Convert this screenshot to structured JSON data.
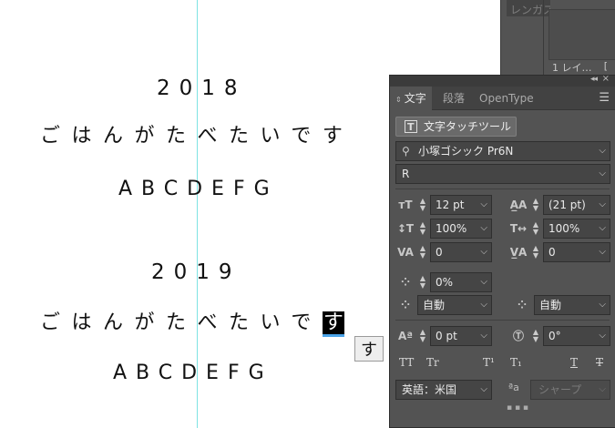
{
  "artboard": {
    "line1": "2018",
    "line2": "ごはんがたべたいです",
    "line3": "ABCDEFG",
    "line4": "2019",
    "line5_main": "ごはんがたべたいで",
    "line5_selected": "す",
    "line6": "ABCDEFG",
    "ime_candidate": "す"
  },
  "background_panel": {
    "tab_label": "レンガス",
    "footer_label": "1 レイ…",
    "footer_menu": "[ "
  },
  "character_panel": {
    "tabs": [
      "文字",
      "段落",
      "OpenType"
    ],
    "touch_tool_label": "文字タッチツール",
    "font_family": "小塚ゴシック Pr6N",
    "font_style": "R",
    "font_size": "12 pt",
    "leading": "(21 pt)",
    "vertical_scale": "100%",
    "horizontal_scale": "100%",
    "kerning": "0",
    "tracking": "0",
    "tsume": "0%",
    "aki_left": "自動",
    "aki_right": "自動",
    "baseline_shift": "0 pt",
    "rotation": "0°",
    "toggles": [
      "TT",
      "Tr",
      "T¹",
      "T₁",
      "T",
      "T"
    ],
    "language": "英語：米国",
    "aa_label": "ªa",
    "antialias": "シャープ"
  },
  "colors": {
    "guide": "#7fe3e3",
    "panel_bg": "#535353",
    "selection_underline": "#4aa3e8"
  }
}
